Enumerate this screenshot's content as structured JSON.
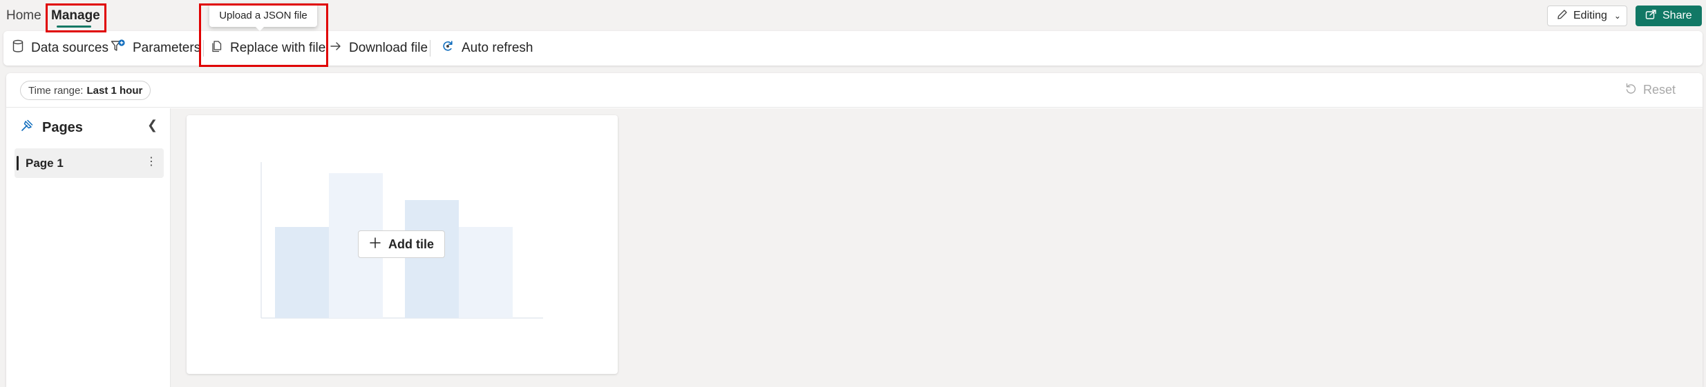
{
  "tabs": {
    "home": "Home",
    "manage": "Manage"
  },
  "header": {
    "editing_label": "Editing",
    "share_label": "Share"
  },
  "toolbar": {
    "data_sources": "Data sources",
    "parameters": "Parameters",
    "replace_with_file": "Replace with file",
    "download_file": "Download file",
    "auto_refresh": "Auto refresh",
    "tooltip": "Upload a JSON file"
  },
  "filter": {
    "time_range_label": "Time range:",
    "time_range_value": "Last 1 hour",
    "reset_label": "Reset"
  },
  "pages": {
    "title": "Pages",
    "items": [
      {
        "label": "Page 1"
      }
    ]
  },
  "canvas": {
    "add_tile_label": "Add tile"
  },
  "colors": {
    "accent": "#117865",
    "highlight": "#e00000",
    "illustration_light": "#eef3fa",
    "illustration_mid": "#dfeaf6"
  }
}
